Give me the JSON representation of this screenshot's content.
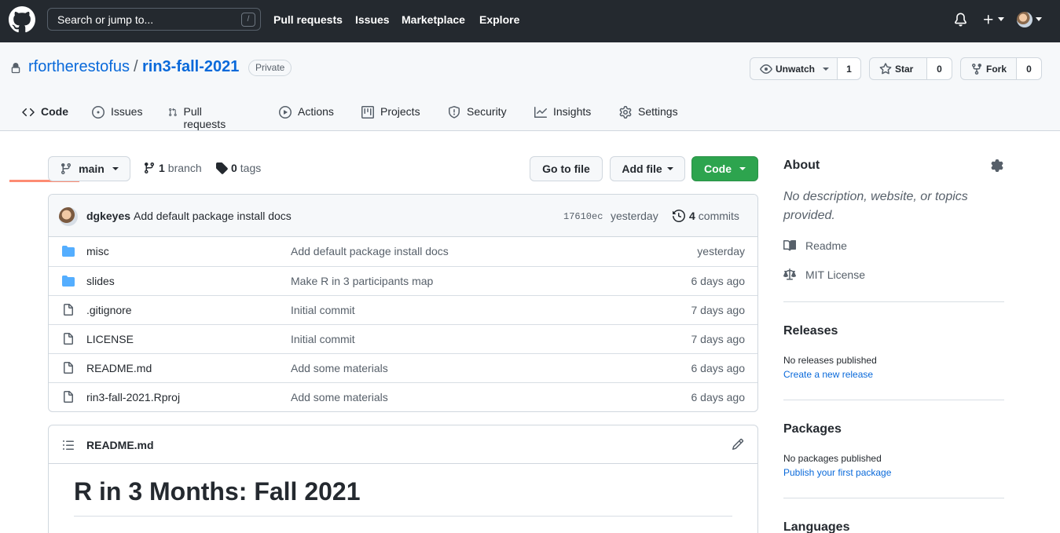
{
  "topbar": {
    "search_placeholder": "Search or jump to...",
    "search_shortcut": "/",
    "nav": [
      "Pull requests",
      "Issues",
      "Marketplace",
      "Explore"
    ]
  },
  "repo": {
    "owner": "rfortherestofus",
    "separator": "/",
    "name": "rin3-fall-2021",
    "visibility": "Private",
    "watch_label": "Unwatch",
    "watch_count": "1",
    "star_label": "Star",
    "star_count": "0",
    "fork_label": "Fork",
    "fork_count": "0"
  },
  "tabs": [
    {
      "label": "Code",
      "icon": "code-icon",
      "active": true
    },
    {
      "label": "Issues",
      "icon": "issue-icon"
    },
    {
      "label": "Pull requests",
      "icon": "pull-request-icon"
    },
    {
      "label": "Actions",
      "icon": "play-icon"
    },
    {
      "label": "Projects",
      "icon": "project-icon"
    },
    {
      "label": "Security",
      "icon": "shield-icon"
    },
    {
      "label": "Insights",
      "icon": "graph-icon"
    },
    {
      "label": "Settings",
      "icon": "gear-icon"
    }
  ],
  "branchbar": {
    "branch": "main",
    "branch_count": "1",
    "branch_word": "branch",
    "tag_count": "0",
    "tag_word": "tags",
    "goto_file": "Go to file",
    "add_file": "Add file",
    "code": "Code"
  },
  "commit": {
    "author": "dgkeyes",
    "message": "Add default package install docs",
    "sha": "17610ec",
    "time": "yesterday",
    "count": "4",
    "count_word": "commits"
  },
  "files": [
    {
      "type": "folder",
      "name": "misc",
      "message": "Add default package install docs",
      "age": "yesterday"
    },
    {
      "type": "folder",
      "name": "slides",
      "message": "Make R in 3 participants map",
      "age": "6 days ago"
    },
    {
      "type": "file",
      "name": ".gitignore",
      "message": "Initial commit",
      "age": "7 days ago"
    },
    {
      "type": "file",
      "name": "LICENSE",
      "message": "Initial commit",
      "age": "7 days ago"
    },
    {
      "type": "file",
      "name": "README.md",
      "message": "Add some materials",
      "age": "6 days ago"
    },
    {
      "type": "file",
      "name": "rin3-fall-2021.Rproj",
      "message": "Add some materials",
      "age": "6 days ago"
    }
  ],
  "readme": {
    "filename": "README.md",
    "heading": "R in 3 Months: Fall 2021"
  },
  "sidebar": {
    "about_title": "About",
    "about_desc": "No description, website, or topics provided.",
    "readme_link": "Readme",
    "license_link": "MIT License",
    "releases_title": "Releases",
    "releases_text": "No releases published",
    "releases_link": "Create a new release",
    "packages_title": "Packages",
    "packages_text": "No packages published",
    "packages_link": "Publish your first package",
    "languages_title": "Languages"
  },
  "colors": {
    "header_bg": "#24292f",
    "link": "#0969da",
    "primary_button": "#2da44e",
    "active_tab_underline": "#fd8c73",
    "folder_icon": "#54aeff"
  }
}
